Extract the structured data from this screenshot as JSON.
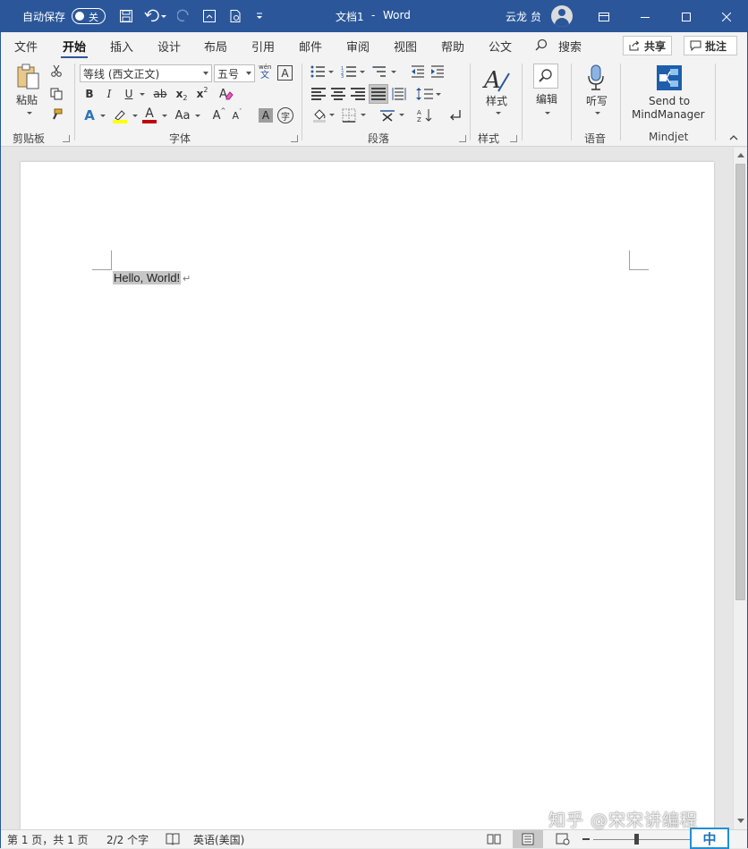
{
  "titlebar": {
    "autosave_label": "自动保存",
    "autosave_state": "关",
    "doc_title": "文档1",
    "app_sep": "-",
    "app_name": "Word",
    "user_name": "云龙 贠"
  },
  "tabs": [
    "文件",
    "开始",
    "插入",
    "设计",
    "布局",
    "引用",
    "邮件",
    "审阅",
    "视图",
    "帮助",
    "公文"
  ],
  "search_label": "搜索",
  "share_label": "共享",
  "comments_label": "批注",
  "ribbon": {
    "clipboard": {
      "paste": "粘贴",
      "group": "剪贴板"
    },
    "font": {
      "name": "等线 (西文正文)",
      "size": "五号",
      "wen_top": "wén",
      "wen_bottom": "文",
      "A_box": "A",
      "bold": "B",
      "italic": "I",
      "underline": "U",
      "strike": "ab",
      "sub": "x",
      "sub_mark": "2",
      "sup": "x",
      "sup_mark": "2",
      "effects": "A",
      "highlight_A": "A",
      "color_A": "A",
      "case": "Aa",
      "grow": "A",
      "shrink": "A",
      "shade_A": "A",
      "circle": "字",
      "group": "字体"
    },
    "paragraph": {
      "group": "段落"
    },
    "styles": {
      "label": "样式",
      "group": "样式"
    },
    "editing": {
      "label": "编辑"
    },
    "voice": {
      "label": "听写",
      "group": "语音"
    },
    "mindjet": {
      "line1": "Send to",
      "line2": "MindManager",
      "group": "Mindjet"
    }
  },
  "document": {
    "text": "Hello, World!",
    "para_mark": "↵"
  },
  "status": {
    "page": "第 1 页，共 1 页",
    "words": "2/2 个字",
    "lang": "英语(美国)"
  },
  "ime": "中",
  "watermark": "知乎 @宋宋讲编程",
  "colors": {
    "brand": "#2b579a",
    "highlight": "#ffff00",
    "font_color": "#c00000"
  }
}
